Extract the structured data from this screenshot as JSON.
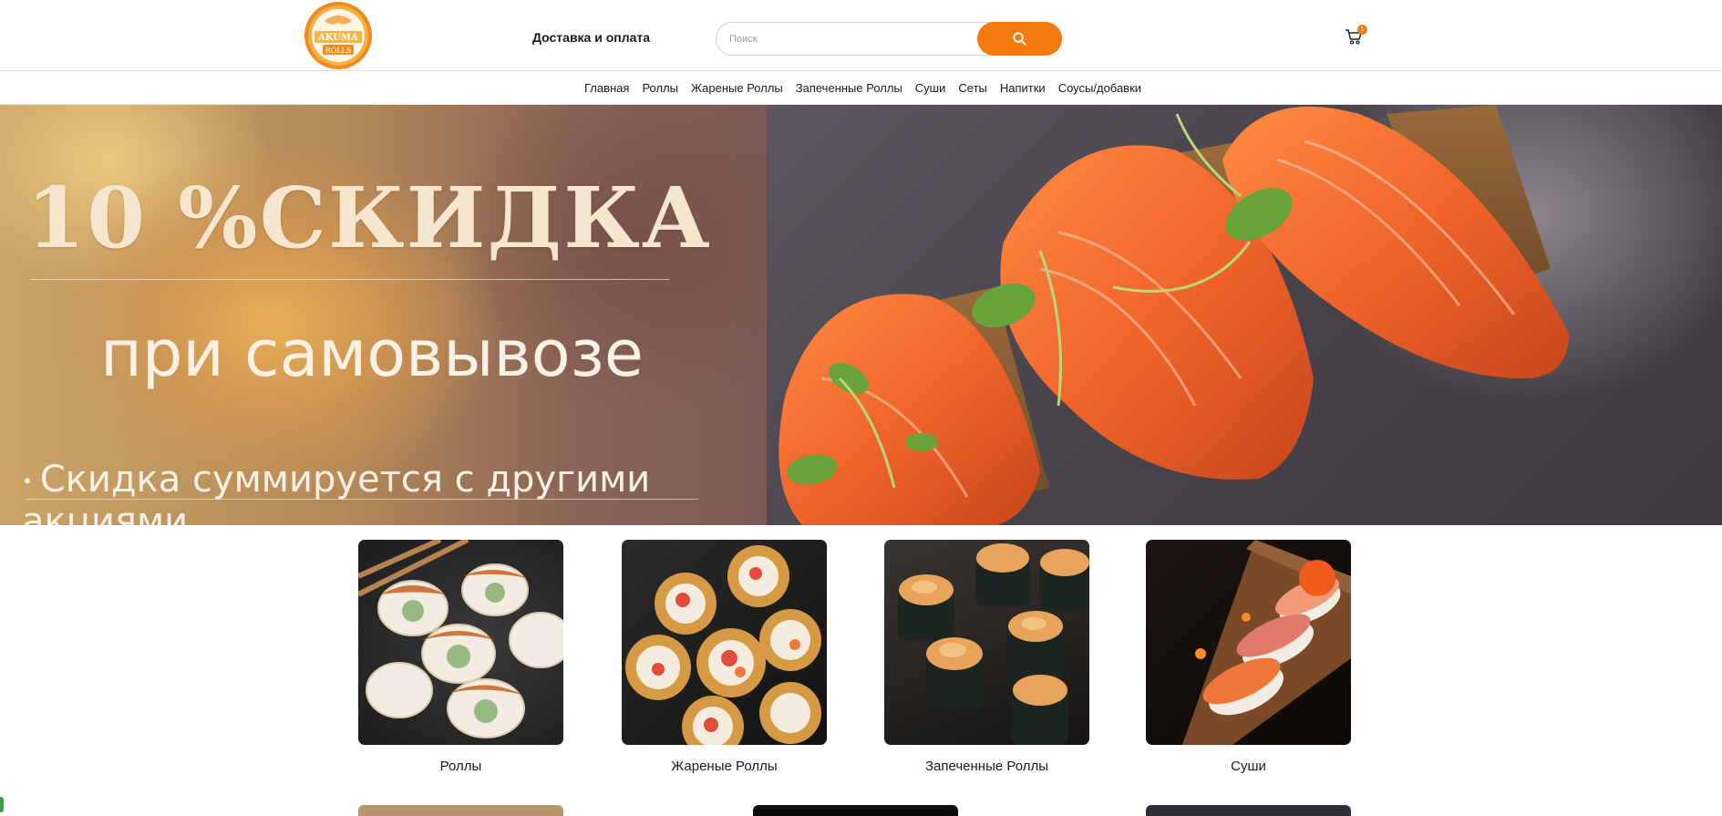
{
  "header": {
    "logo_icon": "akuma-rolls-logo",
    "logo_text_top": "AKUMA",
    "logo_text_bottom": "ROLLS",
    "delivery_link": "Доставка и оплата",
    "search": {
      "placeholder": "Поиск",
      "value": "",
      "button_icon": "search-icon"
    },
    "cart": {
      "icon": "cart-icon",
      "count": "1"
    },
    "accent_color": "#f47a10"
  },
  "nav": {
    "items": [
      {
        "label": "Главная"
      },
      {
        "label": "Роллы"
      },
      {
        "label": "Жареные Роллы"
      },
      {
        "label": "Запеченные Роллы"
      },
      {
        "label": "Суши"
      },
      {
        "label": "Сеты"
      },
      {
        "label": "Напитки"
      },
      {
        "label": "Соусы/добавки"
      }
    ]
  },
  "banner": {
    "title": "10 %СКИДКА",
    "subtitle": "при самовывозе",
    "note_bullet": "•",
    "note": "Скидка суммируется с другими акциями",
    "image": "salmon-sashimi-photo"
  },
  "categories": [
    {
      "label": "Роллы",
      "image": "rolls-photo"
    },
    {
      "label": "Жареные Роллы",
      "image": "fried-rolls-photo"
    },
    {
      "label": "Запеченные Роллы",
      "image": "baked-rolls-photo"
    },
    {
      "label": "Суши",
      "image": "sushi-photo"
    }
  ]
}
